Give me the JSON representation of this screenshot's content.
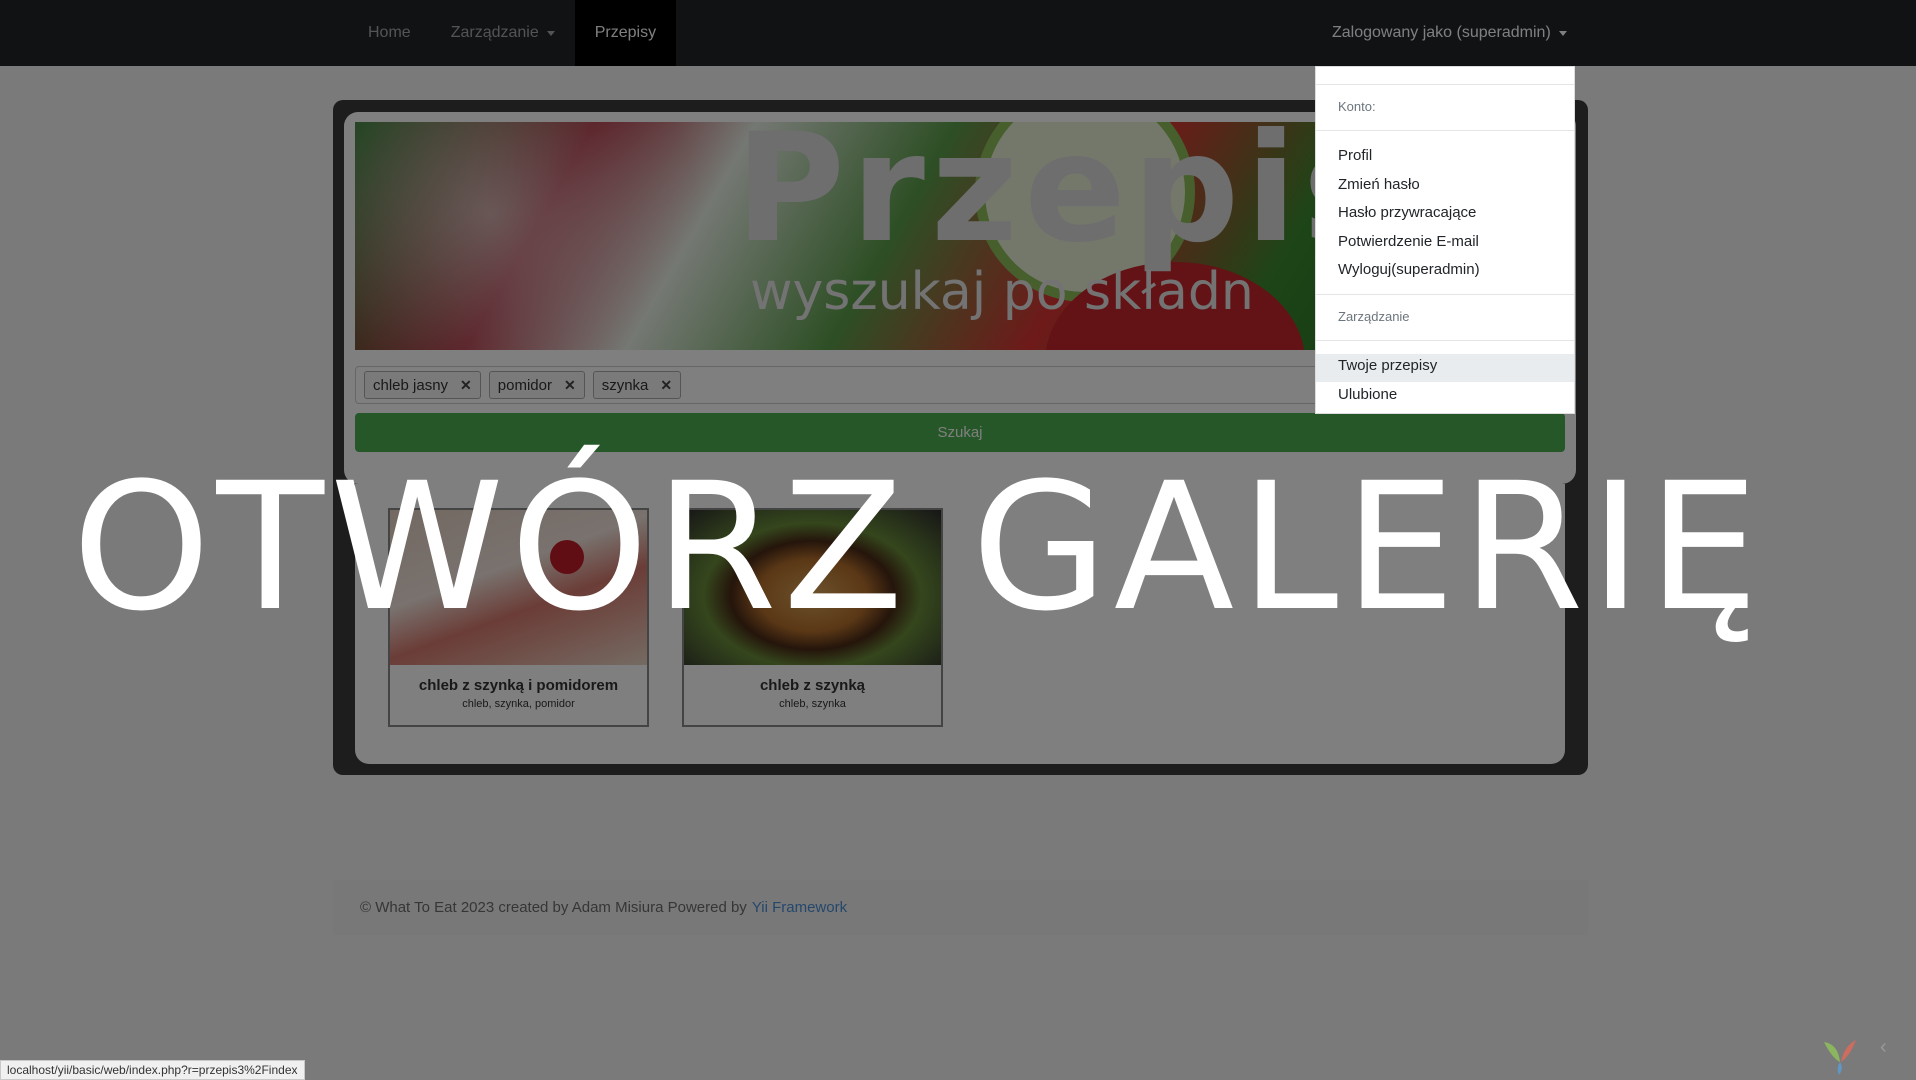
{
  "navbar": {
    "home": "Home",
    "manage": "Zarządzanie",
    "recipes": "Przepisy",
    "user": "Zalogowany jako (superadmin)"
  },
  "dropdown": {
    "account_header": "Konto:",
    "items_account": [
      "Profil",
      "Zmień hasło",
      "Hasło przywracające",
      "Potwierdzenie E-mail",
      "Wyloguj(superadmin)"
    ],
    "manage_header": "Zarządzanie",
    "items_manage": [
      "Twoje przepisy",
      "Ulubione"
    ]
  },
  "banner": {
    "title": "Przepis",
    "subtitle": "wyszukaj po składn"
  },
  "search": {
    "tags": [
      "chleb jasny",
      "pomidor",
      "szynka"
    ],
    "button": "Szukaj"
  },
  "recipes": [
    {
      "title": "chleb z szynką i pomidorem",
      "ingredients": "chleb, szynka, pomidor"
    },
    {
      "title": "chleb z szynką",
      "ingredients": "chleb, szynka"
    }
  ],
  "overlay_text": "OTWÓRZ GALERIĘ",
  "footer": {
    "text": "© What To Eat 2023 created by Adam Misiura Powered by",
    "link": "Yii Framework"
  },
  "status_url": "localhost/yii/basic/web/index.php?r=przepis3%2Findex",
  "colors": {
    "navbar": "#212529",
    "search_button": "#4caf50",
    "footer_link": "#4a8fd8"
  }
}
